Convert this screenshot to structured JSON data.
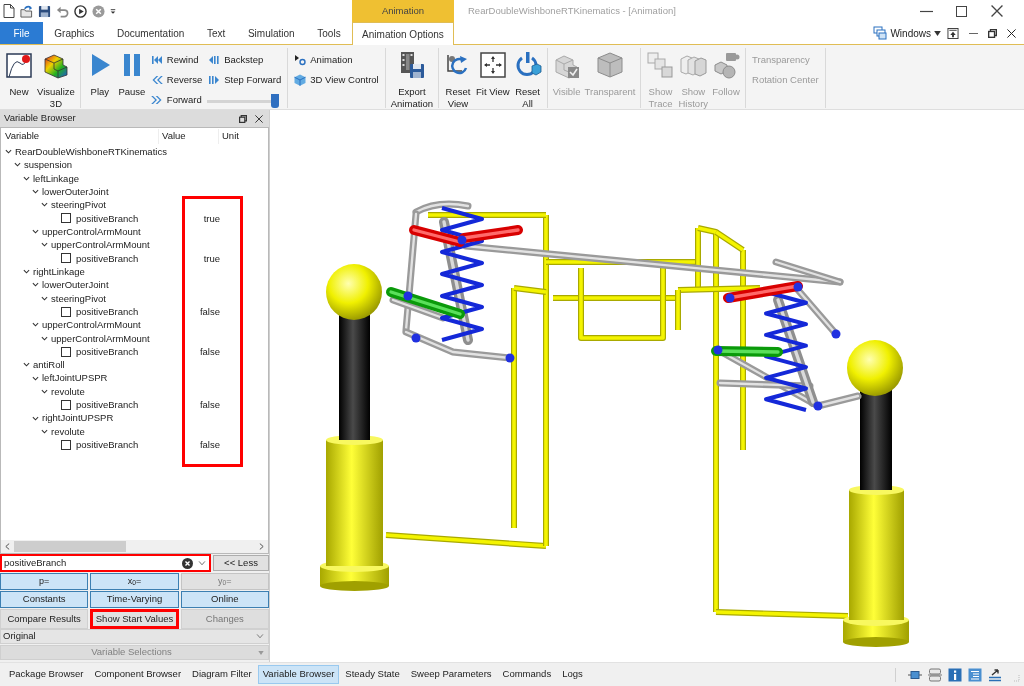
{
  "title_bar": {
    "context_tab": "Animation",
    "title": "RearDoubleWishboneRTKinematics - [Animation]"
  },
  "tabs": [
    {
      "label": "File",
      "kind": "file",
      "selected": false
    },
    {
      "label": "Graphics",
      "kind": "tab",
      "selected": false
    },
    {
      "label": "Documentation",
      "kind": "tab",
      "selected": false
    },
    {
      "label": "Text",
      "kind": "tab",
      "selected": false
    },
    {
      "label": "Simulation",
      "kind": "tab",
      "selected": false
    },
    {
      "label": "Tools",
      "kind": "tab",
      "selected": false
    },
    {
      "label": "Animation Options",
      "kind": "context",
      "selected": true
    }
  ],
  "windows_menu": {
    "label": "Windows"
  },
  "ribbon": {
    "groups": [
      {
        "items": [
          {
            "kind": "large",
            "label": "New",
            "disabled": false
          },
          {
            "kind": "large",
            "label": "Visualize\n3D",
            "disabled": false
          }
        ]
      },
      {
        "items": [
          {
            "kind": "large",
            "label": "Play",
            "disabled": false
          },
          {
            "kind": "large",
            "label": "Pause",
            "disabled": false
          },
          {
            "kind": "small",
            "label": "Rewind",
            "disabled": false
          },
          {
            "kind": "small",
            "label": "Reverse",
            "disabled": false
          },
          {
            "kind": "small",
            "label": "Forward",
            "disabled": false
          },
          {
            "kind": "small",
            "label": "Backstep",
            "disabled": false
          },
          {
            "kind": "small",
            "label": "Step Forward",
            "disabled": false
          },
          {
            "kind": "slider",
            "level": 1
          }
        ]
      },
      {
        "items": [
          {
            "kind": "small",
            "label": "Animation",
            "disabled": false
          },
          {
            "kind": "small",
            "label": "3D View Control",
            "disabled": false
          }
        ]
      },
      {
        "items": [
          {
            "kind": "large",
            "label": "Export\nAnimation",
            "disabled": false
          }
        ]
      },
      {
        "items": [
          {
            "kind": "large",
            "label": "Reset\nView",
            "disabled": false
          },
          {
            "kind": "large",
            "label": "Fit View",
            "disabled": false
          },
          {
            "kind": "large",
            "label": "Reset\nAll",
            "disabled": false
          }
        ]
      },
      {
        "items": [
          {
            "kind": "large",
            "label": "Visible",
            "disabled": true
          },
          {
            "kind": "large",
            "label": "Transparent",
            "disabled": true
          }
        ]
      },
      {
        "items": [
          {
            "kind": "large",
            "label": "Show\nTrace",
            "disabled": true
          },
          {
            "kind": "large",
            "label": "Show\nHistory",
            "disabled": true
          },
          {
            "kind": "large",
            "label": "Follow",
            "disabled": true
          }
        ]
      },
      {
        "items": [
          {
            "kind": "text",
            "label": "Transparency",
            "disabled": true
          },
          {
            "kind": "text",
            "label": "Rotation Center",
            "disabled": true
          }
        ]
      }
    ]
  },
  "variable_browser": {
    "title": "Variable Browser",
    "columns": [
      "Variable",
      "Value",
      "Unit"
    ],
    "tree": [
      {
        "label": "RearDoubleWishboneRTKinematics",
        "kind": "group",
        "expanded": true,
        "children": [
          {
            "label": "suspension",
            "kind": "group",
            "expanded": true,
            "children": [
              {
                "label": "leftLinkage",
                "kind": "group",
                "expanded": true,
                "children": [
                  {
                    "label": "lowerOuterJoint",
                    "kind": "group",
                    "expanded": true,
                    "children": [
                      {
                        "label": "steeringPivot",
                        "kind": "group",
                        "expanded": true,
                        "children": [
                          {
                            "label": "positiveBranch",
                            "kind": "checkbox",
                            "checked": false,
                            "value": "true"
                          }
                        ]
                      }
                    ]
                  },
                  {
                    "label": "upperControlArmMount",
                    "kind": "group",
                    "expanded": true,
                    "children": [
                      {
                        "label": "upperControlArmMount",
                        "kind": "group",
                        "expanded": true,
                        "children": [
                          {
                            "label": "positiveBranch",
                            "kind": "checkbox",
                            "checked": false,
                            "value": "true"
                          }
                        ]
                      }
                    ]
                  }
                ]
              },
              {
                "label": "rightLinkage",
                "kind": "group",
                "expanded": true,
                "children": [
                  {
                    "label": "lowerOuterJoint",
                    "kind": "group",
                    "expanded": true,
                    "children": [
                      {
                        "label": "steeringPivot",
                        "kind": "group",
                        "expanded": true,
                        "children": [
                          {
                            "label": "positiveBranch",
                            "kind": "checkbox",
                            "checked": false,
                            "value": "false"
                          }
                        ]
                      }
                    ]
                  },
                  {
                    "label": "upperControlArmMount",
                    "kind": "group",
                    "expanded": true,
                    "children": [
                      {
                        "label": "upperControlArmMount",
                        "kind": "group",
                        "expanded": true,
                        "children": [
                          {
                            "label": "positiveBranch",
                            "kind": "checkbox",
                            "checked": false,
                            "value": "false"
                          }
                        ]
                      }
                    ]
                  }
                ]
              },
              {
                "label": "antiRoll",
                "kind": "group",
                "expanded": true,
                "children": [
                  {
                    "label": "leftJointUPSPR",
                    "kind": "group",
                    "expanded": true,
                    "children": [
                      {
                        "label": "revolute",
                        "kind": "group",
                        "expanded": true,
                        "children": [
                          {
                            "label": "positiveBranch",
                            "kind": "checkbox",
                            "checked": false,
                            "value": "false"
                          }
                        ]
                      }
                    ]
                  },
                  {
                    "label": "rightJointUPSPR",
                    "kind": "group",
                    "expanded": true,
                    "children": [
                      {
                        "label": "revolute",
                        "kind": "group",
                        "expanded": true,
                        "children": [
                          {
                            "label": "positiveBranch",
                            "kind": "checkbox",
                            "checked": false,
                            "value": "false"
                          }
                        ]
                      }
                    ]
                  }
                ]
              }
            ]
          }
        ]
      }
    ],
    "values_highlighted": true,
    "search": {
      "value": "positiveBranch",
      "highlighted": true
    },
    "less_button": "<< Less",
    "filter_buttons": [
      {
        "label": "p=",
        "on": true
      },
      {
        "label": "x$_{0}$=",
        "on": true
      },
      {
        "label": "y$_{0}$=",
        "on": false
      }
    ],
    "category_buttons": [
      {
        "label": "Constants",
        "on": true
      },
      {
        "label": "Time-Varying",
        "on": true
      },
      {
        "label": "Online",
        "on": true
      }
    ],
    "action_buttons": [
      {
        "label": "Compare Results",
        "disabled": false,
        "highlighted": false
      },
      {
        "label": "Show Start Values",
        "disabled": false,
        "highlighted": true
      },
      {
        "label": "Changes",
        "disabled": true,
        "highlighted": false
      }
    ],
    "result_select": {
      "value": "Original"
    },
    "selections_select": {
      "label": "Variable Selections",
      "disabled": true
    }
  },
  "bottom_tabs": [
    {
      "label": "Package Browser",
      "selected": false
    },
    {
      "label": "Component Browser",
      "selected": false
    },
    {
      "label": "Diagram Filter",
      "selected": false
    },
    {
      "label": "Variable Browser",
      "selected": true
    },
    {
      "label": "Steady State",
      "selected": false
    },
    {
      "label": "Sweep Parameters",
      "selected": false
    },
    {
      "label": "Commands",
      "selected": false
    },
    {
      "label": "Logs",
      "selected": false
    }
  ]
}
